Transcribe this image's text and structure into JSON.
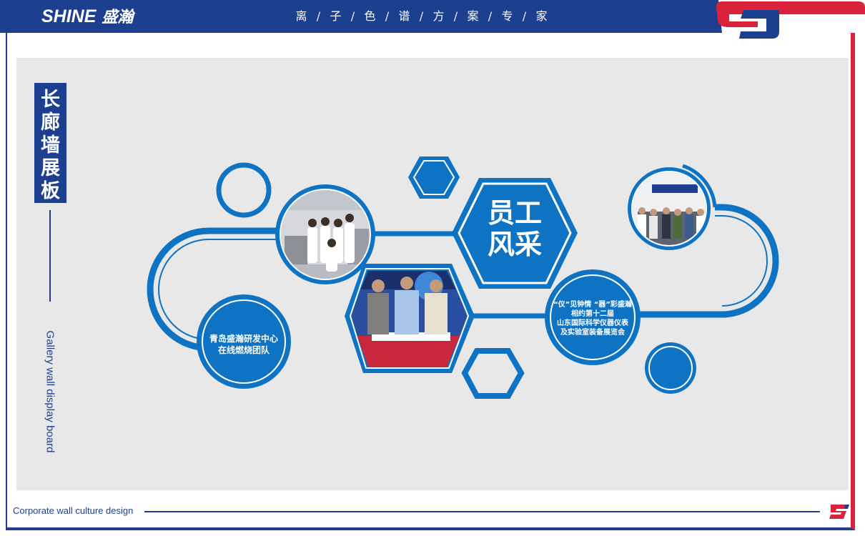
{
  "header": {
    "brand_en": "SHINE",
    "brand_cn": "盛瀚",
    "slogan_chars": [
      "离",
      "子",
      "色",
      "谱",
      "方",
      "案",
      "专",
      "家"
    ]
  },
  "sidebar": {
    "title_chars": [
      "长",
      "廊",
      "墙",
      "展",
      "板"
    ],
    "subtitle_en": "Gallery wall display board"
  },
  "main": {
    "center_title_line1": "员工",
    "center_title_line2": "风采",
    "left_caption_line1": "青岛盛瀚研发中心",
    "left_caption_line2": "在线燃烧团队",
    "right_caption_lines": [
      "“仪”见钟情 “器”彩盛瀚",
      "相约第十二届",
      "山东国际科学仪器仪表",
      "及实验室装备展览会"
    ]
  },
  "footer": {
    "text": "Corporate wall culture design"
  },
  "colors": {
    "navy": "#1d3f8f",
    "blue": "#0f73c4",
    "red": "#d9233a",
    "panel": "#e8e8e8"
  }
}
